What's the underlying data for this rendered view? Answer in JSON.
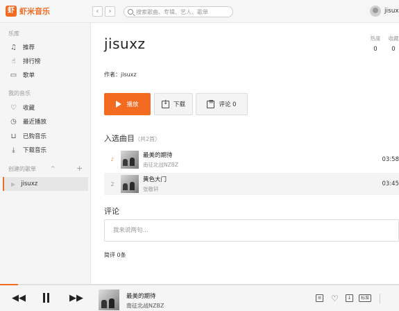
{
  "app": {
    "brand_mark": "虾",
    "brand": "虾米音乐",
    "username": "jisuxz",
    "accent_color": "#f26b21"
  },
  "nav": {
    "back_icon": "chevron-left-icon",
    "forward_icon": "chevron-right-icon"
  },
  "search": {
    "placeholder": "搜索歌曲、专辑、艺人、歌单",
    "value": ""
  },
  "sidebar": {
    "library_title": "乐库",
    "library_items": [
      {
        "label": "推荐",
        "icon": "music-note-icon"
      },
      {
        "label": "排行榜",
        "icon": "hand-icon"
      },
      {
        "label": "歌单",
        "icon": "playlist-icon"
      }
    ],
    "my_music_title": "我的音乐",
    "my_music_items": [
      {
        "label": "收藏",
        "icon": "heart-icon"
      },
      {
        "label": "最近播放",
        "icon": "clock-icon"
      },
      {
        "label": "已购音乐",
        "icon": "cart-icon"
      },
      {
        "label": "下载音乐",
        "icon": "download-icon"
      }
    ],
    "created_title": "创建的歌单",
    "created_caret": "^",
    "add_symbol": "+",
    "created_items": [
      {
        "label": "jisuxz",
        "selected": true
      }
    ]
  },
  "playlist": {
    "title": "jisuxz",
    "author_prefix": "作者：",
    "author": "jisuxz",
    "stats": [
      {
        "label": "热度",
        "value": "0"
      },
      {
        "label": "收藏",
        "value": "0"
      }
    ],
    "play_label": "播放",
    "download_label": "下载",
    "comment_label": "评论 0",
    "songs_heading": "入选曲目",
    "songs_count": "（共2首）",
    "songs": [
      {
        "index": "♪",
        "playing": true,
        "name": "最美的期待",
        "artist": "南征北战NZBZ",
        "duration": "03:58"
      },
      {
        "index": "2",
        "playing": false,
        "name": "黄色大门",
        "artist": "张敬轩",
        "duration": "03:45"
      }
    ]
  },
  "comments": {
    "heading": "评论",
    "placeholder": "我来说两句...",
    "count_text": "简评 0条"
  },
  "player": {
    "progress": 0.045,
    "title": "最美的期待",
    "artist": "南征北战NZBZ",
    "prev_icon": "previous-icon",
    "pause_icon": "pause-icon",
    "next_icon": "next-icon",
    "quality_label": "标准"
  }
}
